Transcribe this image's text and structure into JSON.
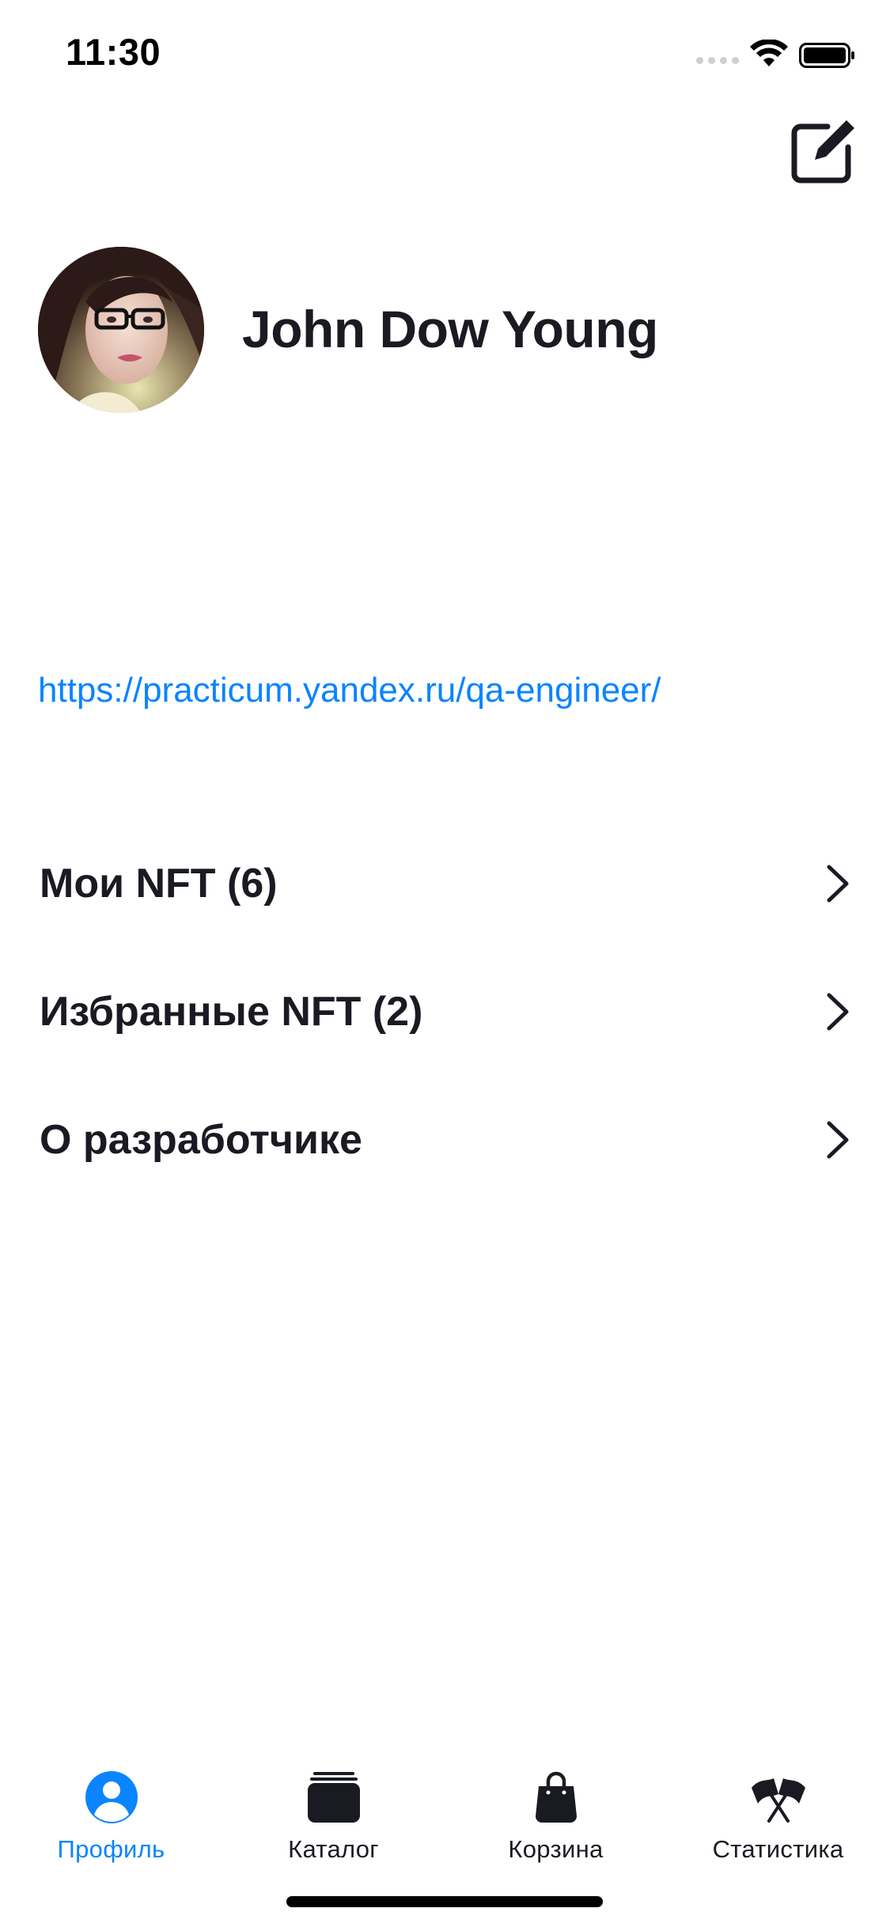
{
  "status_bar": {
    "time": "11:30"
  },
  "profile": {
    "name": "John Dow Young",
    "website": "https://practicum.yandex.ru/qa-engineer/"
  },
  "menu": [
    {
      "label": "Мои NFT (6)"
    },
    {
      "label": "Избранные NFT (2)"
    },
    {
      "label": "О разработчике"
    }
  ],
  "tabs": [
    {
      "label": "Профиль",
      "icon": "profile-icon",
      "active": true
    },
    {
      "label": "Каталог",
      "icon": "catalog-icon",
      "active": false
    },
    {
      "label": "Корзина",
      "icon": "cart-icon",
      "active": false
    },
    {
      "label": "Статистика",
      "icon": "statistics-icon",
      "active": false
    }
  ],
  "colors": {
    "accent": "#0A84FF",
    "text": "#1A1B22",
    "background": "#FFFFFF"
  }
}
